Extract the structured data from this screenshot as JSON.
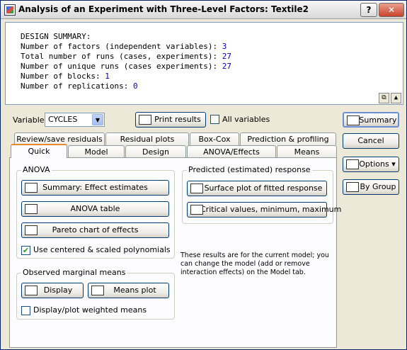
{
  "window": {
    "title": "Analysis of an Experiment with Three-Level Factors: Textile2",
    "help_btn": "?",
    "close_btn": "✕"
  },
  "report": {
    "heading": "DESIGN SUMMARY:",
    "lines": [
      {
        "label": "Number of factors (independent variables): ",
        "value": "3"
      },
      {
        "label": "Total number of runs (cases, experiments): ",
        "value": "27"
      },
      {
        "label": "Number of unique runs (cases experiments): ",
        "value": "27"
      },
      {
        "label": "Number of blocks: ",
        "value": "1"
      },
      {
        "label": "Number of replications: ",
        "value": "0"
      }
    ]
  },
  "variable": {
    "label": "Variable:",
    "value": "CYCLES"
  },
  "print_results": "Print results",
  "all_variables": "All variables",
  "tabs_back": [
    "Review/save residuals",
    "Residual plots",
    "Box-Cox",
    "Prediction & profiling"
  ],
  "tabs_front": [
    "Quick",
    "Model",
    "Design",
    "ANOVA/Effects",
    "Means"
  ],
  "active_tab": "Quick",
  "anova": {
    "title": "ANOVA",
    "summary_btn": "Summary:  Effect estimates",
    "anova_table_btn": "ANOVA table",
    "pareto_btn": "Pareto chart of effects",
    "use_centered": "Use centered & scaled polynomials",
    "use_centered_checked": true
  },
  "predicted": {
    "title": "Predicted (estimated) response",
    "surface_btn": "Surface plot of fitted response",
    "critical_btn": "Critical values, minimum, maximum"
  },
  "note": "These results are for the current model; you can change the model (add or remove interaction effects) on the Model tab.",
  "marginal": {
    "title": "Observed marginal means",
    "display_btn": "Display",
    "means_plot_btn": "Means plot",
    "weighted": "Display/plot weighted means",
    "weighted_checked": false
  },
  "side_buttons": {
    "summary": "Summary",
    "cancel": "Cancel",
    "options": "Options",
    "by_group": "By Group"
  }
}
